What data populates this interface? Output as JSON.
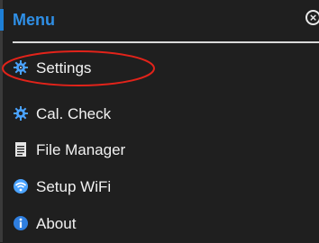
{
  "menu": {
    "title": "Menu",
    "close_icon": "close-circle-icon",
    "items": [
      {
        "label": "Settings",
        "icon": "gear-icon",
        "icon_color": "#4aa3ff"
      },
      {
        "label": "Cal. Check",
        "icon": "gear-icon",
        "icon_color": "#4aa3ff"
      },
      {
        "label": "File Manager",
        "icon": "document-icon",
        "icon_color": "#e6e6e6"
      },
      {
        "label": "Setup WiFi",
        "icon": "wifi-icon",
        "icon_color": "#4aa3ff"
      },
      {
        "label": "About",
        "icon": "info-icon",
        "icon_color": "#2f7fe0"
      }
    ]
  },
  "annotation": {
    "highlight_color": "#e2231a",
    "highlighted_item": "Settings"
  },
  "colors": {
    "background": "#1f1f1f",
    "accent": "#2f8fe6",
    "text": "#f2f2f2"
  }
}
